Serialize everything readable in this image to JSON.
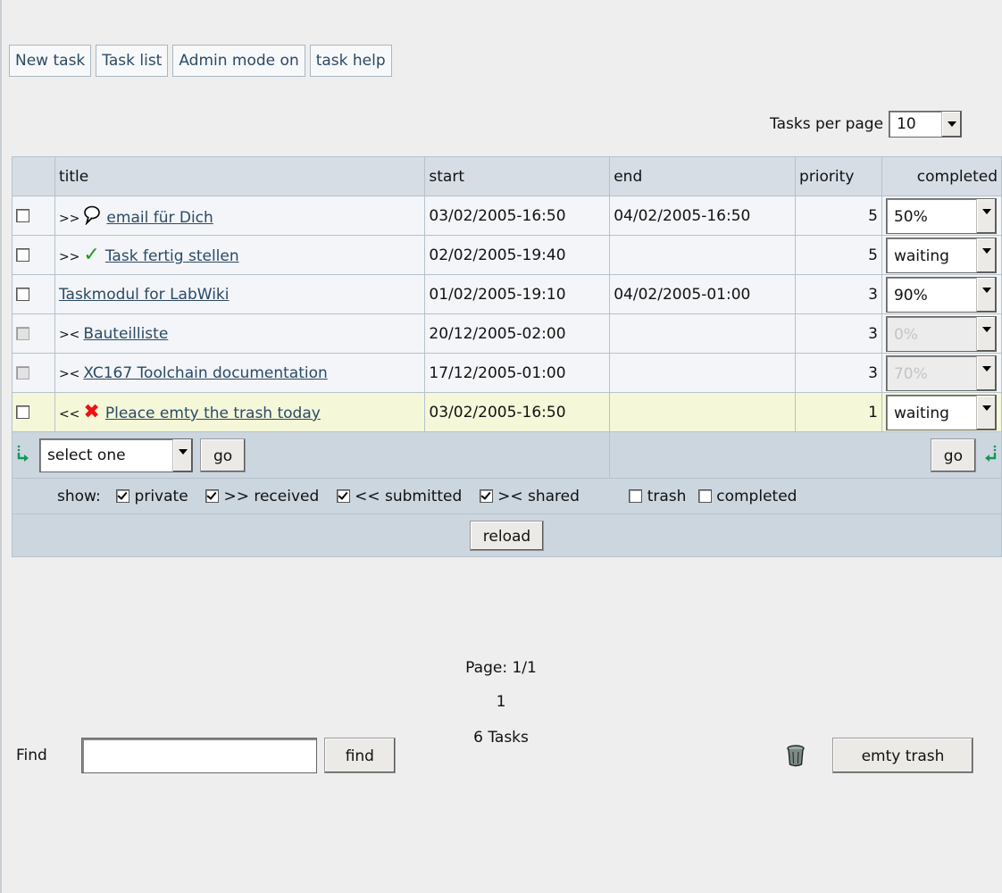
{
  "nav": {
    "new_task": "New task",
    "task_list": "Task list",
    "admin_mode": "Admin mode on",
    "task_help": "task help"
  },
  "tasks_per_page": {
    "label": "Tasks per page",
    "value": "10"
  },
  "table": {
    "headers": {
      "title": "title",
      "start": "start",
      "end": "end",
      "priority": "priority",
      "completed": "completed"
    },
    "rows": [
      {
        "prefix": ">>",
        "icon": "speech-bubble-icon",
        "title": "email für Dich",
        "start": "03/02/2005-16:50",
        "end": "04/02/2005-16:50",
        "priority": "5",
        "completed": "50%"
      },
      {
        "prefix": ">>",
        "icon": "green-check-icon",
        "title": "Task fertig stellen",
        "start": "02/02/2005-19:40",
        "end": "",
        "priority": "5",
        "completed": "waiting"
      },
      {
        "prefix": "",
        "icon": "",
        "title": "Taskmodul for LabWiki",
        "start": "01/02/2005-19:10",
        "end": "04/02/2005-01:00",
        "priority": "3",
        "completed": "90%"
      },
      {
        "prefix": "><",
        "icon": "",
        "title": "Bauteilliste",
        "start": "20/12/2005-02:00",
        "end": "",
        "priority": "3",
        "completed": "0%"
      },
      {
        "prefix": "><",
        "icon": "",
        "title": "XC167 Toolchain documentation",
        "start": "17/12/2005-01:00",
        "end": "",
        "priority": "3",
        "completed": "70%"
      },
      {
        "prefix": "<<",
        "icon": "red-x-icon",
        "title": "Pleace emty the trash today",
        "start": "03/02/2005-16:50",
        "end": "",
        "priority": "1",
        "completed": "waiting"
      }
    ]
  },
  "actions": {
    "select_placeholder": "select one",
    "go_left": "go",
    "go_right": "go"
  },
  "show_filters": {
    "label": "show:",
    "items": [
      {
        "label": "private",
        "checked": true
      },
      {
        "label": ">> received",
        "checked": true
      },
      {
        "label": "<< submitted",
        "checked": true
      },
      {
        "label": ">< shared",
        "checked": true
      },
      {
        "label": "trash",
        "checked": false
      },
      {
        "label": "completed",
        "checked": false
      }
    ]
  },
  "reload": "reload",
  "pager": {
    "page": "Page: 1/1",
    "number": "1",
    "count": "6 Tasks"
  },
  "find": {
    "label": "Find",
    "value": "",
    "button": "find"
  },
  "trash": {
    "button": "emty trash",
    "icon": "trash-can-icon"
  },
  "colors": {
    "header": "#d6dde4",
    "row": "#f3f5f8",
    "highlight": "#f5f7d9",
    "link": "#2b4a66",
    "check": "#1d9a1d",
    "x": "#e11111"
  }
}
